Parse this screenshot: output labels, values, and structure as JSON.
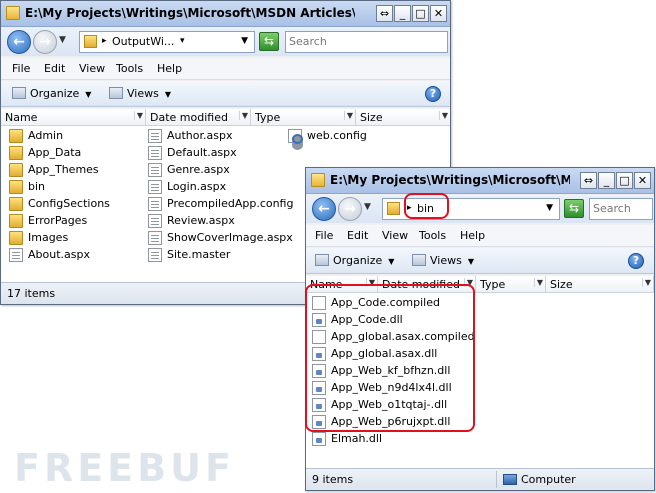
{
  "window_back": {
    "title": "E:\\My Projects\\Writings\\Microsoft\\MSDN Articles\\MSDN Onli",
    "address": "OutputWi...",
    "search_placeholder": "Search",
    "menu": [
      "File",
      "Edit",
      "View",
      "Tools",
      "Help"
    ],
    "toolbar": {
      "organize": "Organize",
      "views": "Views"
    },
    "columns": [
      "Name",
      "Date modified",
      "Type",
      "Size"
    ],
    "files_col1": [
      {
        "name": "Admin",
        "icon": "folder-icon"
      },
      {
        "name": "App_Data",
        "icon": "folder-icon"
      },
      {
        "name": "App_Themes",
        "icon": "folder-icon"
      },
      {
        "name": "bin",
        "icon": "folder-icon"
      },
      {
        "name": "ConfigSections",
        "icon": "folder-icon"
      },
      {
        "name": "ErrorPages",
        "icon": "folder-icon"
      },
      {
        "name": "Images",
        "icon": "folder-icon"
      },
      {
        "name": "About.aspx",
        "icon": "document-icon"
      }
    ],
    "files_col2": [
      {
        "name": "Author.aspx",
        "icon": "document-icon"
      },
      {
        "name": "Default.aspx",
        "icon": "document-icon"
      },
      {
        "name": "Genre.aspx",
        "icon": "document-icon"
      },
      {
        "name": "Login.aspx",
        "icon": "document-icon"
      },
      {
        "name": "PrecompiledApp.config",
        "icon": "document-icon"
      },
      {
        "name": "Review.aspx",
        "icon": "document-icon"
      },
      {
        "name": "ShowCoverImage.aspx",
        "icon": "document-icon"
      },
      {
        "name": "Site.master",
        "icon": "document-icon"
      }
    ],
    "files_col3": [
      {
        "name": "web.config",
        "icon": "config-icon"
      }
    ],
    "status": "17 items"
  },
  "window_front": {
    "title": "E:\\My Projects\\Writings\\Microsoft\\MSDN A",
    "address": "bin",
    "search_placeholder": "Search",
    "menu": [
      "File",
      "Edit",
      "View",
      "Tools",
      "Help"
    ],
    "toolbar": {
      "organize": "Organize",
      "views": "Views"
    },
    "columns": [
      "Name",
      "Date modified",
      "Type",
      "Size"
    ],
    "files": [
      {
        "name": "App_Code.compiled",
        "icon": "blank-file-icon"
      },
      {
        "name": "App_Code.dll",
        "icon": "dll-icon"
      },
      {
        "name": "App_global.asax.compiled",
        "icon": "blank-file-icon"
      },
      {
        "name": "App_global.asax.dll",
        "icon": "dll-icon"
      },
      {
        "name": "App_Web_kf_bfhzn.dll",
        "icon": "dll-icon"
      },
      {
        "name": "App_Web_n9d4lx4l.dll",
        "icon": "dll-icon"
      },
      {
        "name": "App_Web_o1tqtaj-.dll",
        "icon": "dll-icon"
      },
      {
        "name": "App_Web_p6rujxpt.dll",
        "icon": "dll-icon"
      },
      {
        "name": "Elmah.dll",
        "icon": "dll-icon"
      }
    ],
    "status": "9 items",
    "status_zone": "Computer"
  },
  "title_buttons": {
    "restore": "⇔",
    "minimize": "_",
    "maximize": "□",
    "close": "✕"
  },
  "watermark": "FREEBUF"
}
